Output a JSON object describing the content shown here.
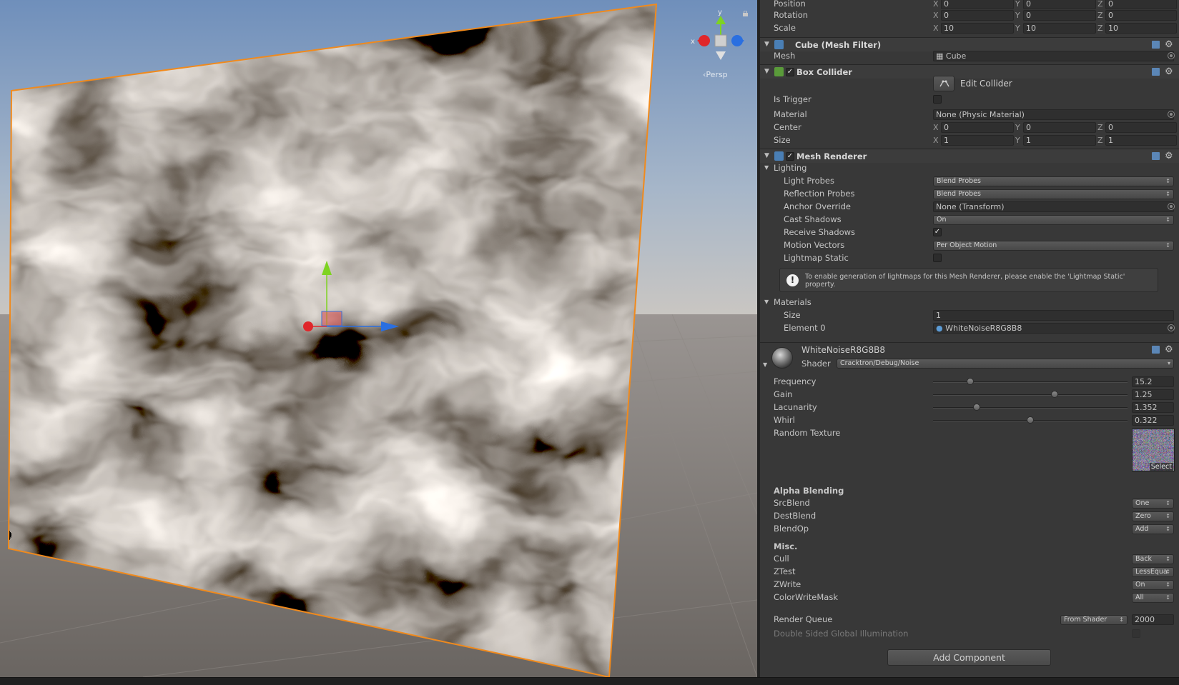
{
  "scene": {
    "persp_label": "Persp",
    "gizmo_axes": {
      "x": "x",
      "y": "y"
    }
  },
  "transform": {
    "position": {
      "label": "Position",
      "x": "0",
      "y": "0",
      "z": "0"
    },
    "rotation": {
      "label": "Rotation",
      "x": "0",
      "y": "0",
      "z": "0"
    },
    "scale": {
      "label": "Scale",
      "x": "10",
      "y": "10",
      "z": "10"
    }
  },
  "axis_labels": {
    "x": "X",
    "y": "Y",
    "z": "Z"
  },
  "mesh_filter": {
    "title": "Cube (Mesh Filter)",
    "mesh_label": "Mesh",
    "mesh_value": "Cube"
  },
  "box_collider": {
    "title": "Box Collider",
    "enabled": true,
    "edit_collider": "Edit Collider",
    "is_trigger": {
      "label": "Is Trigger",
      "checked": false
    },
    "material": {
      "label": "Material",
      "value": "None (Physic Material)"
    },
    "center": {
      "label": "Center",
      "x": "0",
      "y": "0",
      "z": "0"
    },
    "size": {
      "label": "Size",
      "x": "1",
      "y": "1",
      "z": "1"
    }
  },
  "mesh_renderer": {
    "title": "Mesh Renderer",
    "enabled": true,
    "lighting_section": "Lighting",
    "light_probes": {
      "label": "Light Probes",
      "value": "Blend Probes"
    },
    "reflection_probes": {
      "label": "Reflection Probes",
      "value": "Blend Probes"
    },
    "anchor_override": {
      "label": "Anchor Override",
      "value": "None (Transform)"
    },
    "cast_shadows": {
      "label": "Cast Shadows",
      "value": "On"
    },
    "receive_shadows": {
      "label": "Receive Shadows",
      "checked": true
    },
    "motion_vectors": {
      "label": "Motion Vectors",
      "value": "Per Object Motion"
    },
    "lightmap_static": {
      "label": "Lightmap Static",
      "checked": false
    },
    "help_text": "To enable generation of lightmaps for this Mesh Renderer, please enable the 'Lightmap Static' property.",
    "materials_section": "Materials",
    "materials_size": {
      "label": "Size",
      "value": "1"
    },
    "element0": {
      "label": "Element 0",
      "value": "WhiteNoiseR8G8B8"
    }
  },
  "material": {
    "name": "WhiteNoiseR8G8B8",
    "shader_label": "Shader",
    "shader_value": "Cracktron/Debug/Noise",
    "frequency": {
      "label": "Frequency",
      "value": "15.2",
      "fraction": 0.19
    },
    "gain": {
      "label": "Gain",
      "value": "1.25",
      "fraction": 0.625
    },
    "lacunarity": {
      "label": "Lacunarity",
      "value": "1.352",
      "fraction": 0.225
    },
    "whirl": {
      "label": "Whirl",
      "value": "0.322",
      "fraction": 0.5
    },
    "random_texture": {
      "label": "Random Texture",
      "select": "Select"
    },
    "alpha_blending_title": "Alpha Blending",
    "src_blend": {
      "label": "SrcBlend",
      "value": "One"
    },
    "dest_blend": {
      "label": "DestBlend",
      "value": "Zero"
    },
    "blend_op": {
      "label": "BlendOp",
      "value": "Add"
    },
    "misc_title": "Misc.",
    "cull": {
      "label": "Cull",
      "value": "Back"
    },
    "ztest": {
      "label": "ZTest",
      "value": "LessEqua"
    },
    "zwrite": {
      "label": "ZWrite",
      "value": "On"
    },
    "color_write_mask": {
      "label": "ColorWriteMask",
      "value": "All"
    },
    "render_queue": {
      "label": "Render Queue",
      "mode": "From Shader",
      "value": "2000"
    },
    "double_sided_gi": {
      "label": "Double Sided Global Illumination",
      "checked": false
    }
  },
  "add_component": "Add Component",
  "colors": {
    "selection_outline": "#f08a1d",
    "sky_top": "#7d9ac0",
    "ground": "#75706c",
    "inspector_bg": "#383838",
    "gizmo_x": "#e0262a",
    "gizmo_y": "#7ed321",
    "gizmo_z": "#2a6fe0"
  },
  "icons": {
    "mesh_filter": "grid-icon",
    "box_collider": "green-cube-icon",
    "mesh_renderer": "renderer-icon",
    "help": "exclamation-icon",
    "settings": "gear-icon",
    "reference": "book-icon"
  }
}
